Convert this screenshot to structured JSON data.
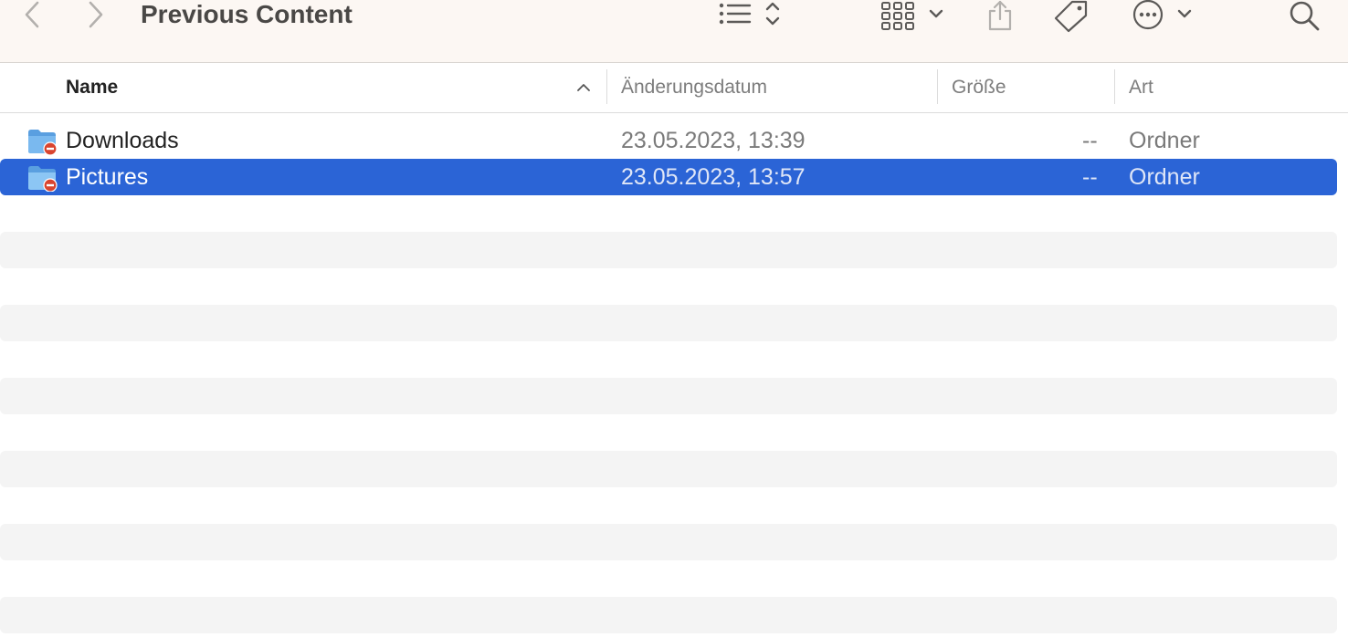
{
  "toolbar": {
    "title": "Previous Content",
    "icons": {
      "back": "chevron-left-icon",
      "forward": "chevron-right-icon",
      "list_view": "list-icon",
      "grid_view": "grid-icon",
      "share": "share-icon",
      "tag": "tag-icon",
      "more": "ellipsis-circle-icon",
      "search": "magnifier-icon"
    }
  },
  "columns": {
    "name": "Name",
    "modified": "Änderungsdatum",
    "size": "Größe",
    "kind": "Art"
  },
  "files": [
    {
      "name": "Downloads",
      "modified": "23.05.2023, 13:39",
      "size": "--",
      "kind": "Ordner",
      "selected": false
    },
    {
      "name": "Pictures",
      "modified": "23.05.2023, 13:57",
      "size": "--",
      "kind": "Ordner",
      "selected": true
    }
  ],
  "colors": {
    "selection": "#2b64d6",
    "toolbar_bg": "#fcf7f3",
    "folder_blue": "#6aaee8",
    "badge_red": "#d9442f"
  }
}
